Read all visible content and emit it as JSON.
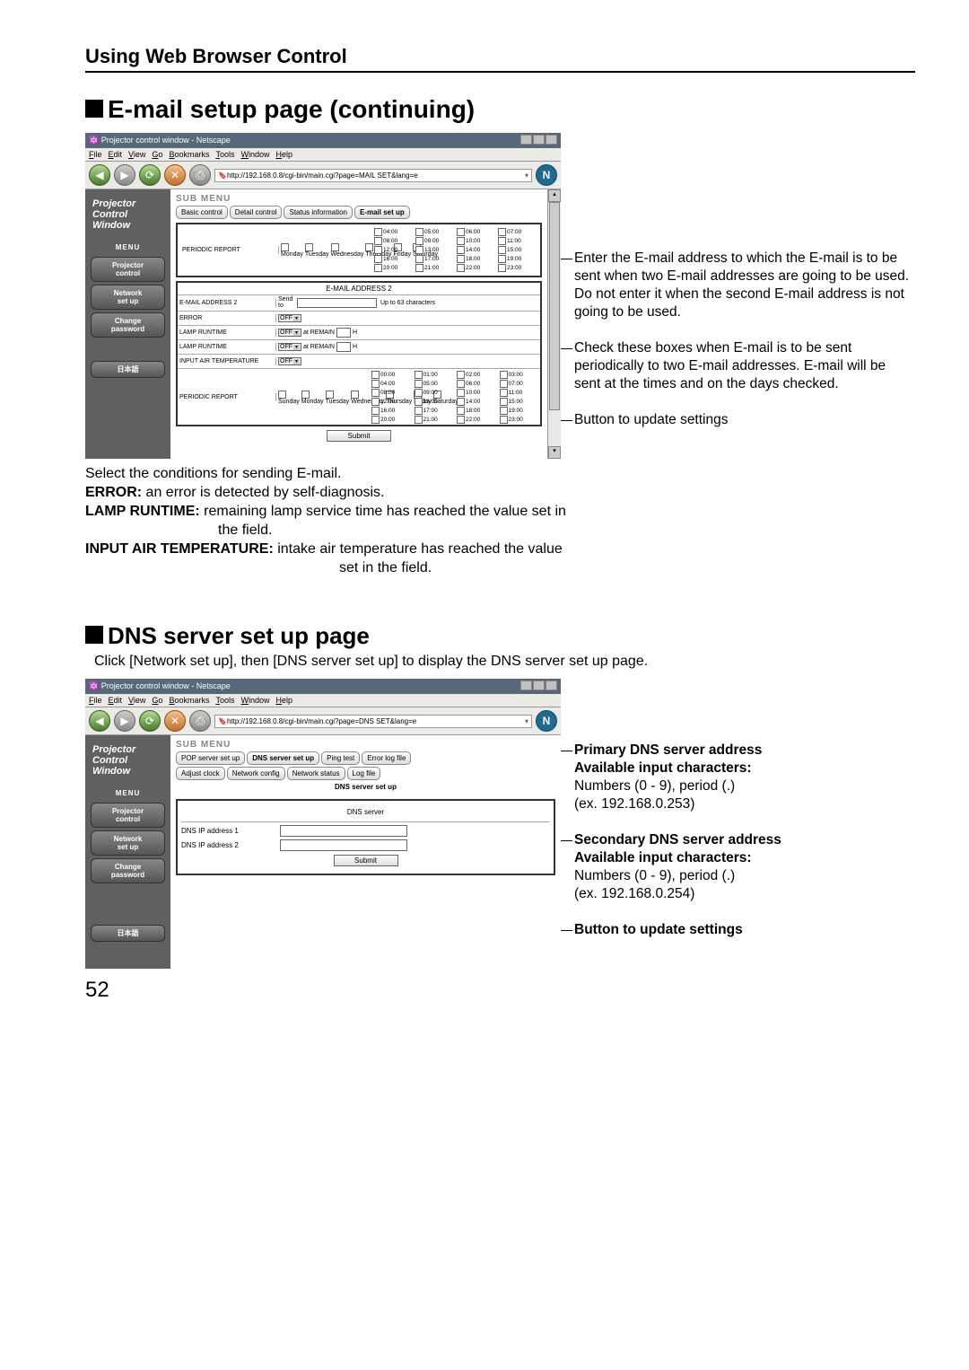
{
  "chapterTitle": "Using Web Browser Control",
  "section1": {
    "title": "E-mail setup page (continuing)"
  },
  "section2": {
    "title": "DNS server set up page",
    "desc": "Click [Network set up], then [DNS server set up] to display the DNS server set up page."
  },
  "window": {
    "title": "Projector control window - Netscape",
    "menus": [
      "File",
      "Edit",
      "View",
      "Go",
      "Bookmarks",
      "Tools",
      "Window",
      "Help"
    ],
    "url1": "http://192.168.0.8/cgi-bin/main.cgi?page=MAIL SET&lang=e",
    "url2": "http://192.168.0.8/cgi-bin/main.cgi?page=DNS SET&lang=e"
  },
  "sidebar": {
    "logoL1": "Projector",
    "logoL2": "Control",
    "logoL3": "Window",
    "menuLabel": "MENU",
    "items": [
      "Projector\ncontrol",
      "Network\nset up",
      "Change\npassword"
    ],
    "jp": "日本語"
  },
  "submenu": {
    "label": "SUB MENU",
    "tabs1": [
      "Basic control",
      "Detail control",
      "Status information",
      "E-mail set up"
    ],
    "tabs2L1": [
      "POP server set up",
      "DNS server set up",
      "Ping test",
      "Error log file"
    ],
    "tabs2L2": [
      "Adjust clock",
      "Network config",
      "Network status",
      "Log file"
    ]
  },
  "email": {
    "periodic": "PERIODIC REPORT",
    "days": [
      "Monday",
      "Tuesday",
      "Wednesday",
      "Thursday",
      "Friday",
      "Saturday"
    ],
    "daysFull": [
      "Sunday",
      "Monday",
      "Tuesday",
      "Wednesday",
      "Thursday",
      "Friday",
      "Saturday"
    ],
    "times1": [
      "04:00",
      "05:00",
      "06:00",
      "07:00",
      "08:00",
      "09:00",
      "10:00",
      "11:00",
      "12:00",
      "13:00",
      "14:00",
      "15:00",
      "16:00",
      "17:00",
      "18:00",
      "19:00",
      "20:00",
      "21:00",
      "22:00",
      "23:00"
    ],
    "times2": [
      "00:00",
      "01:00",
      "02:00",
      "03:00",
      "04:00",
      "05:00",
      "06:00",
      "07:00",
      "08:00",
      "09:00",
      "10:00",
      "11:00",
      "12:00",
      "13:00",
      "14:00",
      "15:00",
      "16:00",
      "17:00",
      "18:00",
      "19:00",
      "20:00",
      "21:00",
      "22:00",
      "23:00"
    ],
    "sec2title": "E-MAIL ADDRESS 2",
    "rows": {
      "addr": "E-MAIL ADDRESS 2",
      "sendto": "Send to",
      "hint": "Up to 63 characters",
      "error": "ERROR",
      "lamp": "LAMP RUNTIME",
      "off": "OFF",
      "atRemain": "at REMAIN",
      "h": "H",
      "input": "INPUT AIR TEMPERATURE"
    },
    "submit": "Submit"
  },
  "dns": {
    "title": "DNS server set up",
    "subhead": "DNS server",
    "row1": "DNS IP address 1",
    "row2": "DNS IP address 2",
    "submit": "Submit"
  },
  "annotations1": {
    "a1": "Enter the E-mail address to which the E-mail is to be sent when two E-mail addresses are going to be used. Do not enter it when the second E-mail address is not going to be used.",
    "a2": "Check these boxes when E-mail is to be sent periodically to two E-mail addresses. E-mail will be sent at the times and on the days checked.",
    "a3": "Button to update settings"
  },
  "annotations2": {
    "a1t": "Primary DNS server address",
    "a1b": "Available input characters:",
    "a1c": "Numbers (0 - 9), period (.)\n(ex. 192.168.0.253)",
    "a2t": "Secondary DNS server address",
    "a2b": "Available input characters:",
    "a2c": "Numbers (0 - 9), period (.)\n(ex. 192.168.0.254)",
    "a3": "Button to update settings"
  },
  "below": {
    "l1": "Select the conditions for sending E-mail.",
    "l2a": "ERROR:",
    "l2b": " an error is detected by self-diagnosis.",
    "l3a": "LAMP RUNTIME:",
    "l3b": " remaining lamp service time has reached the value set in",
    "l3c": "the field.",
    "l4a": "INPUT AIR TEMPERATURE:",
    "l4b": " intake air temperature has reached the value",
    "l4c": "set in the field."
  },
  "pageNumber": "52"
}
